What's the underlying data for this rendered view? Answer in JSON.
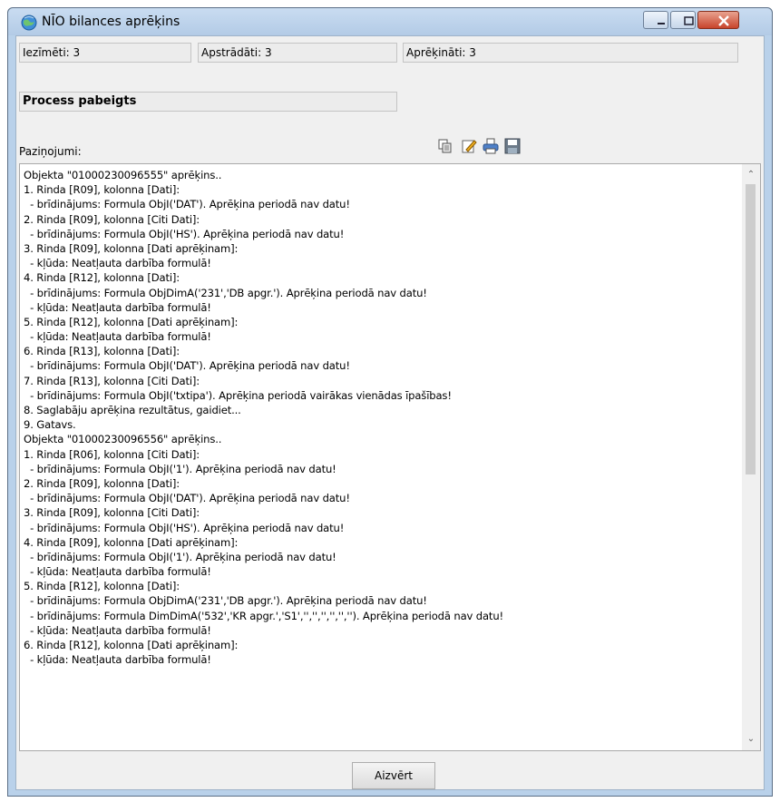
{
  "window": {
    "title": "NĪO bilances aprēķins"
  },
  "status": {
    "marked": "Iezīmēti: 3",
    "processed": "Apstrādāti: 3",
    "calculated": "Aprēķināti: 3",
    "process": "Process pabeigts"
  },
  "messages_label": "Paziņojumi:",
  "toolbar": {
    "icons": [
      "copy-icon",
      "edit-icon",
      "print-icon",
      "save-icon"
    ]
  },
  "log": [
    "Objekta \"01000230096555\" aprēķins..",
    "1. Rinda [R09], kolonna [Dati]:",
    "  - brīdinājums: Formula ObjI('DAT'). Aprēķina periodā nav datu!",
    "2. Rinda [R09], kolonna [Citi Dati]:",
    "  - brīdinājums: Formula ObjI('HS'). Aprēķina periodā nav datu!",
    "3. Rinda [R09], kolonna [Dati aprēķinam]:",
    "  - kļūda: Neatļauta darbība formulā!",
    "4. Rinda [R12], kolonna [Dati]:",
    "  - brīdinājums: Formula ObjDimA('231','DB apgr.'). Aprēķina periodā nav datu!",
    "  - kļūda: Neatļauta darbība formulā!",
    "5. Rinda [R12], kolonna [Dati aprēķinam]:",
    "  - kļūda: Neatļauta darbība formulā!",
    "6. Rinda [R13], kolonna [Dati]:",
    "  - brīdinājums: Formula ObjI('DAT'). Aprēķina periodā nav datu!",
    "7. Rinda [R13], kolonna [Citi Dati]:",
    "  - brīdinājums: Formula ObjI('txtipa'). Aprēķina periodā vairākas vienādas īpašības!",
    "8. Saglabāju aprēķina rezultātus, gaidiet...",
    "9. Gatavs.",
    "Objekta \"01000230096556\" aprēķins..",
    "1. Rinda [R06], kolonna [Citi Dati]:",
    "  - brīdinājums: Formula ObjI('1'). Aprēķina periodā nav datu!",
    "2. Rinda [R09], kolonna [Dati]:",
    "  - brīdinājums: Formula ObjI('DAT'). Aprēķina periodā nav datu!",
    "3. Rinda [R09], kolonna [Citi Dati]:",
    "  - brīdinājums: Formula ObjI('HS'). Aprēķina periodā nav datu!",
    "4. Rinda [R09], kolonna [Dati aprēķinam]:",
    "  - brīdinājums: Formula ObjI('1'). Aprēķina periodā nav datu!",
    "  - kļūda: Neatļauta darbība formulā!",
    "5. Rinda [R12], kolonna [Dati]:",
    "  - brīdinājums: Formula ObjDimA('231','DB apgr.'). Aprēķina periodā nav datu!",
    "  - brīdinājums: Formula DimDimA('532','KR apgr.','S1','','','','','',''). Aprēķina periodā nav datu!",
    "  - kļūda: Neatļauta darbība formulā!",
    "6. Rinda [R12], kolonna [Dati aprēķinam]:",
    "  - kļūda: Neatļauta darbība formulā!"
  ],
  "close_label": "Aizvērt"
}
